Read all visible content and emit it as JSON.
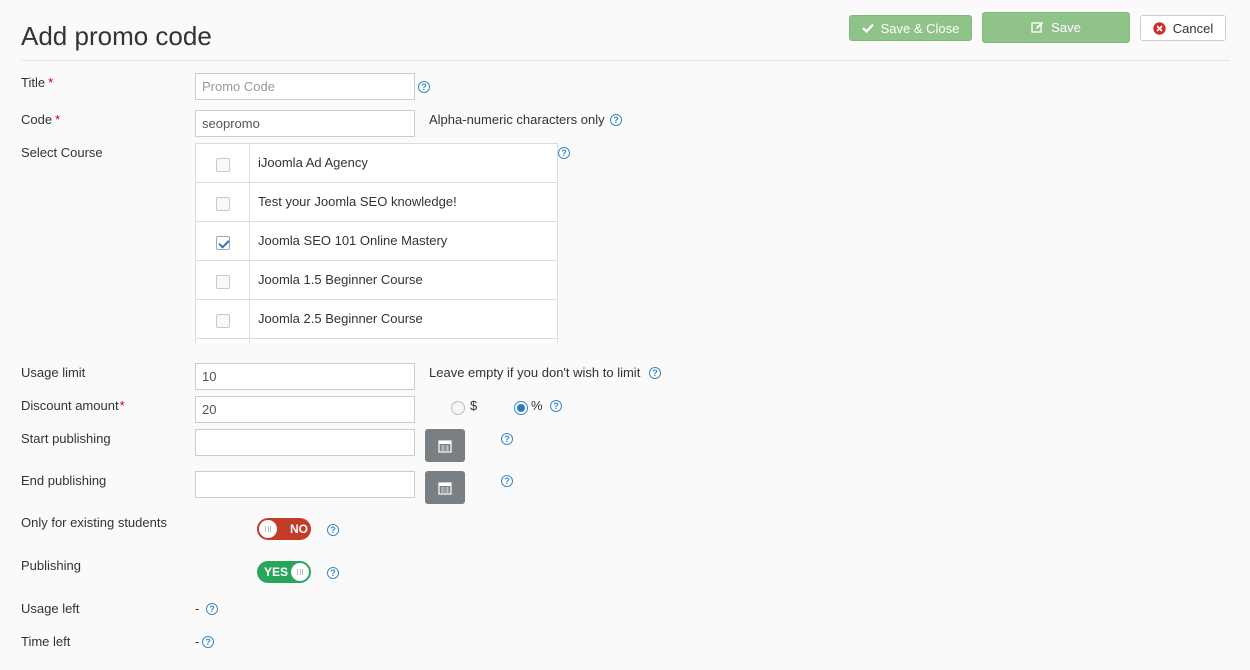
{
  "page": {
    "title": "Add promo code"
  },
  "toolbar": {
    "save_close": "Save & Close",
    "save": "Save",
    "cancel": "Cancel"
  },
  "colors": {
    "accent_green": "#8fc38a",
    "toggle_no": "#c23c2a",
    "toggle_yes": "#27a55c",
    "help_blue": "#3a87c0"
  },
  "form": {
    "title": {
      "label": "Title",
      "required": "*",
      "value": "",
      "placeholder": "Promo Code"
    },
    "code": {
      "label": "Code",
      "required": "*",
      "value": "seopromo",
      "hint": "Alpha-numeric characters only"
    },
    "select_course": {
      "label": "Select Course",
      "courses": [
        {
          "name": "iJoomla Ad Agency",
          "checked": false
        },
        {
          "name": "Test your Joomla SEO knowledge!",
          "checked": false
        },
        {
          "name": "Joomla SEO 101 Online Mastery",
          "checked": true
        },
        {
          "name": "Joomla 1.5 Beginner Course",
          "checked": false
        },
        {
          "name": "Joomla 2.5 Beginner Course",
          "checked": false
        }
      ]
    },
    "usage_limit": {
      "label": "Usage limit",
      "value": "10",
      "hint": "Leave empty if you don't wish to limit"
    },
    "discount_amount": {
      "label": "Discount amount",
      "required": "*",
      "value": "20",
      "options": [
        "$",
        "%"
      ],
      "selected": "%"
    },
    "start_publishing": {
      "label": "Start publishing",
      "value": ""
    },
    "end_publishing": {
      "label": "End publishing",
      "value": ""
    },
    "only_existing": {
      "label": "Only for existing students",
      "state": "NO"
    },
    "publishing": {
      "label": "Publishing",
      "state": "YES"
    },
    "usage_left": {
      "label": "Usage left",
      "value": "-"
    },
    "time_left": {
      "label": "Time left",
      "value": "-"
    }
  },
  "help_glyph": "?",
  "icons": {
    "save_close": "check-icon",
    "save": "edit-icon",
    "cancel": "close-circle-icon",
    "calendar": "calendar-icon",
    "help": "help-icon"
  }
}
